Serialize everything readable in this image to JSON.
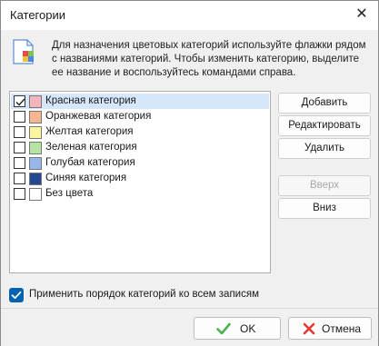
{
  "window": {
    "title": "Категории",
    "close_glyph": "✕"
  },
  "info": {
    "icon": "categories-icon",
    "text": "Для назначения цветовых категорий используйте флажки рядом с названиями категорий. Чтобы изменить категорию, выделите ее название и воспользуйтесь командами справа."
  },
  "categories": [
    {
      "label": "Красная категория",
      "color": "#f2b5bd",
      "checked": true,
      "selected": true
    },
    {
      "label": "Оранжевая категория",
      "color": "#f7b592",
      "checked": false,
      "selected": false
    },
    {
      "label": "Желтая категория",
      "color": "#f8f59e",
      "checked": false,
      "selected": false
    },
    {
      "label": "Зеленая категория",
      "color": "#b5e3a3",
      "checked": false,
      "selected": false
    },
    {
      "label": "Голубая категория",
      "color": "#97b6ea",
      "checked": false,
      "selected": false
    },
    {
      "label": "Синяя категория",
      "color": "#24478f",
      "checked": false,
      "selected": false
    },
    {
      "label": "Без цвета",
      "color": "#ffffff",
      "checked": false,
      "selected": false
    }
  ],
  "buttons": {
    "add": "Добавить",
    "edit": "Редактировать",
    "delete": "Удалить",
    "up": "Вверх",
    "down": "Вниз"
  },
  "apply_all": {
    "label": "Применить порядок категорий ко всем записям",
    "checked": true
  },
  "footer": {
    "ok": "OK",
    "cancel": "Отмена"
  },
  "colors": {
    "accent": "#0063b1",
    "ok_icon": "#4caf50",
    "cancel_icon": "#e53935"
  }
}
